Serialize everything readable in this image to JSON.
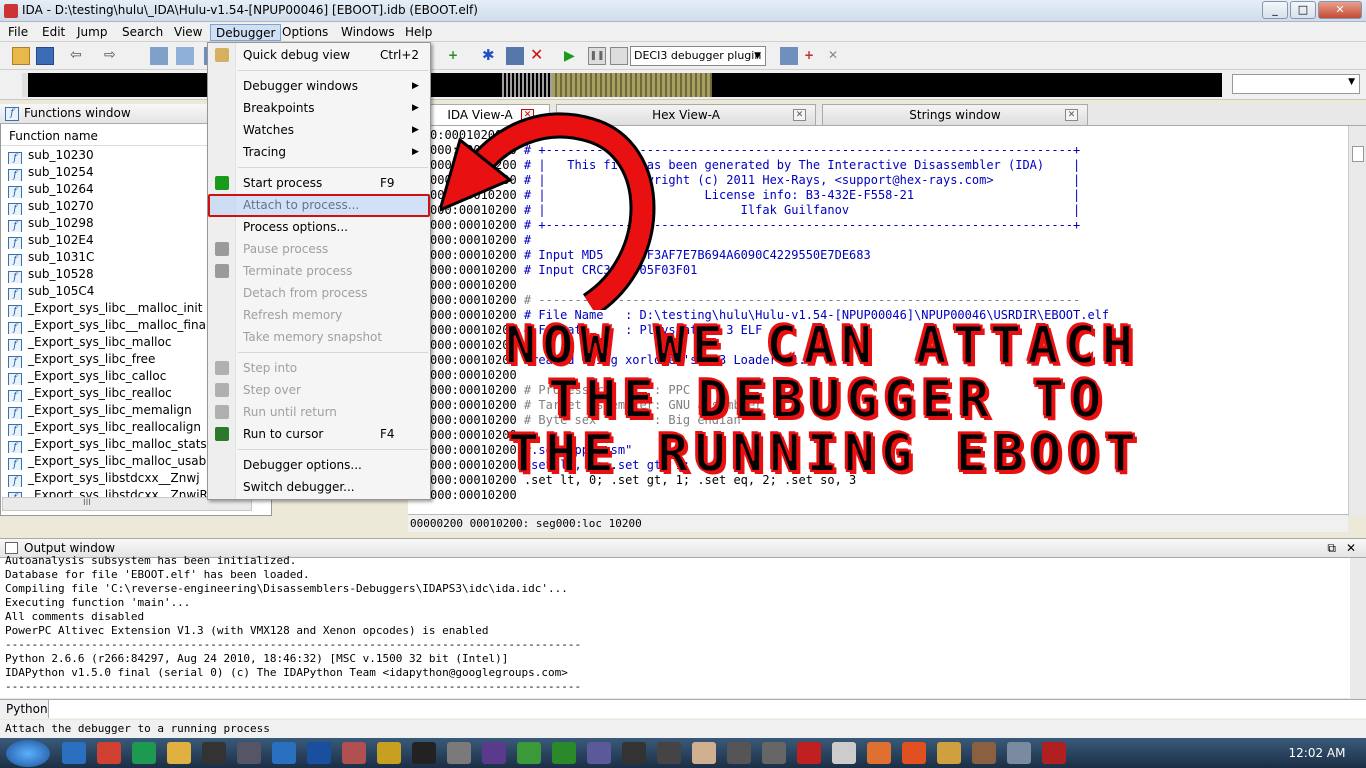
{
  "window": {
    "title": "IDA - D:\\testing\\hulu\\_IDA\\Hulu-v1.54-[NPUP00046] [EBOOT].idb (EBOOT.elf)"
  },
  "menubar": [
    "File",
    "Edit",
    "Jump",
    "Search",
    "View",
    "Debugger",
    "Options",
    "Windows",
    "Help"
  ],
  "toolbar": {
    "debugger_select": "DECI3 debugger plugin"
  },
  "functions": {
    "title": "Functions window",
    "column": "Function name",
    "items": [
      "sub_10230",
      "sub_10254",
      "sub_10264",
      "sub_10270",
      "sub_10298",
      "sub_102E4",
      "sub_1031C",
      "sub_10528",
      "sub_105C4",
      "_Export_sys_libc__malloc_init",
      "_Export_sys_libc__malloc_finalize",
      "_Export_sys_libc_malloc",
      "_Export_sys_libc_free",
      "_Export_sys_libc_calloc",
      "_Export_sys_libc_realloc",
      "_Export_sys_libc_memalign",
      "_Export_sys_libc_reallocalign",
      "_Export_sys_libc_malloc_stats",
      "_Export_sys_libc_malloc_usable_si",
      "_Export_sys_libstdcxx__Znwj",
      "_Export_sys_libstdcxx__ZnwjRKSt9n"
    ],
    "hscroll": "III"
  },
  "tabs": [
    {
      "label": "IDA View-A"
    },
    {
      "label": "Hex View-A"
    },
    {
      "label": "Strings window"
    }
  ],
  "disasm": [
    {
      "addr": "0:00010200",
      "t": "",
      "c": "",
      "cls": ""
    },
    {
      "addr": "000:00010200",
      "t": " # ",
      "c": "+-------------------------------------------------------------------------+",
      "cls": "cmt"
    },
    {
      "addr": "000:00010200",
      "t": " # ",
      "c": "|   This file has been generated by The Interactive Disassembler (IDA)    |",
      "cls": "cmt"
    },
    {
      "addr": "000:00010200",
      "t": " # ",
      "c": "|           Copyright (c) 2011 Hex-Rays, <support@hex-rays.com>           |",
      "cls": "cmt"
    },
    {
      "addr": "000:00010200",
      "t": " # ",
      "c": "|                      License info: B3-432E-F558-21                      |",
      "cls": "cmt"
    },
    {
      "addr": "000:00010200",
      "t": " # ",
      "c": "|                           Ilfak Guilfanov                               |",
      "cls": "cmt"
    },
    {
      "addr": "000:00010200",
      "t": " # ",
      "c": "+-------------------------------------------------------------------------+",
      "cls": "cmt"
    },
    {
      "addr": "000:00010200",
      "t": " # ",
      "c": "",
      "cls": "cmt"
    },
    {
      "addr": "000:00010200",
      "t": " # ",
      "c": "Input MD5   : 6F3AF7E7B694A6090C4229550E7DE683",
      "cls": "cmt"
    },
    {
      "addr": "000:00010200",
      "t": " # ",
      "c": "Input CRC32 : 05F03F01",
      "cls": "cmt"
    },
    {
      "addr": "000:00010200",
      "t": "",
      "c": "",
      "cls": ""
    },
    {
      "addr": "000:00010200",
      "t": " # ",
      "c": "---------------------------------------------------------------------------",
      "cls": "gry"
    },
    {
      "addr": "000:00010200",
      "t": " # ",
      "c": "File Name   : D:\\testing\\hulu\\Hulu-v1.54-[NPUP00046]\\NPUP00046\\USRDIR\\EBOOT.elf",
      "cls": "cmt"
    },
    {
      "addr": "000:00010200",
      "t": " # ",
      "c": "Format      : Playstation 3 ELF",
      "cls": "cmt"
    },
    {
      "addr": "000:00010200",
      "t": "",
      "c": "",
      "cls": ""
    },
    {
      "addr": "000:00010200",
      "t": " ",
      "c": "created using xorloser's PS3 Loader v1.",
      "cls": "cmt"
    },
    {
      "addr": "000:00010200",
      "t": "",
      "c": "",
      "cls": ""
    },
    {
      "addr": "000:00010200",
      "t": " # ",
      "c": "Processor       : PPC",
      "cls": "gry"
    },
    {
      "addr": "000:00010200",
      "t": " # ",
      "c": "Target assembler: GNU assembler",
      "cls": "gry"
    },
    {
      "addr": "000:00010200",
      "t": " # ",
      "c": "Byte sex        : Big endian",
      "cls": "gry"
    },
    {
      "addr": "000:00010200",
      "t": "",
      "c": "",
      "cls": ""
    },
    {
      "addr": "000:00010200",
      "t": " ",
      "c": "#.set \"ppc-asm\"",
      "cls": "cmt"
    },
    {
      "addr": "000:00010200",
      "t": " ",
      "c": ".set lt, 0; .set gt, 1;",
      "cls": "cmt"
    },
    {
      "addr": "000:00010200",
      "t": " ",
      "c": ".set lt, 0; .set gt, 1; .set eq, 2; .set so, 3",
      "cls": ""
    },
    {
      "addr": "000:00010200",
      "t": "",
      "c": "",
      "cls": ""
    }
  ],
  "status_strip": "00000200 00010200: seg000:loc 10200",
  "output": {
    "title": "Output window",
    "lines": [
      "Autoanalysis subsystem has been initialized.",
      "Database for file 'EBOOT.elf' has been loaded.",
      "Compiling file 'C:\\reverse-engineering\\Disassemblers-Debuggers\\IDAPS3\\idc\\ida.idc'...",
      "Executing function 'main'...",
      "All comments disabled",
      "PowerPC Altivec Extension V1.3 (with VMX128 and Xenon opcodes) is enabled",
      "---------------------------------------------------------------------------------------",
      "Python 2.6.6 (r266:84297, Aug 24 2010, 18:46:32) [MSC v.1500 32 bit (Intel)]",
      "IDAPython v1.5.0 final (serial 0) (c) The IDAPython Team <idapython@googlegroups.com>",
      "---------------------------------------------------------------------------------------"
    ]
  },
  "python_label": "Python",
  "hint": "Attach the debugger to a running process",
  "debugger_menu": [
    {
      "label": "Quick debug view",
      "shortcut": "Ctrl+2",
      "disabled": false
    },
    {
      "label": "Debugger windows",
      "submenu": true
    },
    {
      "label": "Breakpoints",
      "submenu": true
    },
    {
      "label": "Watches",
      "submenu": true
    },
    {
      "label": "Tracing",
      "submenu": true
    },
    {
      "label": "Start process",
      "shortcut": "F9"
    },
    {
      "label": "Attach to process..."
    },
    {
      "label": "Process options..."
    },
    {
      "label": "Pause process",
      "disabled": true
    },
    {
      "label": "Terminate process",
      "disabled": true
    },
    {
      "label": "Detach from process",
      "disabled": true
    },
    {
      "label": "Refresh memory",
      "disabled": true
    },
    {
      "label": "Take memory snapshot",
      "disabled": true
    },
    {
      "label": "Step into",
      "disabled": true
    },
    {
      "label": "Step over",
      "disabled": true
    },
    {
      "label": "Run until return",
      "disabled": true
    },
    {
      "label": "Run to cursor",
      "shortcut": "F4"
    },
    {
      "label": "Debugger options..."
    },
    {
      "label": "Switch debugger..."
    }
  ],
  "overlay": [
    "NOW WE CAN ATTACH",
    "THE DEBUGGER TO",
    "THE RUNNING EBOOT"
  ],
  "clock": "12:02 AM",
  "colors": {
    "annotation": "#e81010",
    "comment": "#0000c0"
  }
}
